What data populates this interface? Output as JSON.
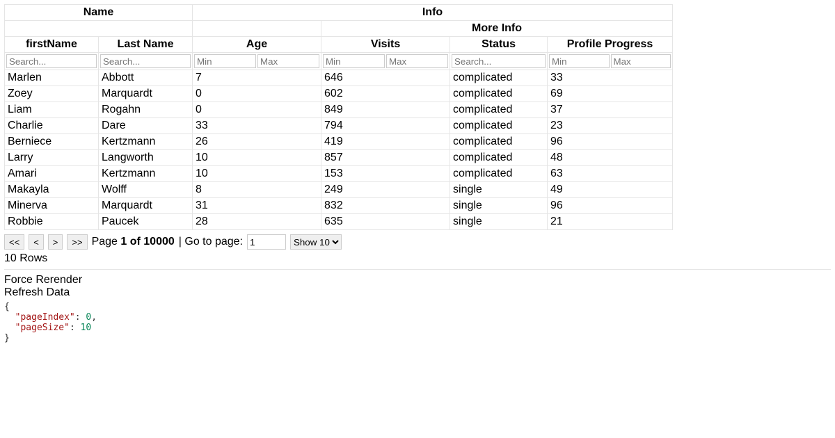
{
  "headers": {
    "group_name": "Name",
    "group_info": "Info",
    "group_more": "More Info",
    "firstName": "firstName",
    "lastName": "Last Name",
    "age": "Age",
    "visits": "Visits",
    "status": "Status",
    "progress": "Profile Progress"
  },
  "filters": {
    "search_placeholder": "Search...",
    "min_placeholder": "Min",
    "max_placeholder": "Max"
  },
  "rows": [
    {
      "firstName": "Marlen",
      "lastName": "Abbott",
      "age": 7,
      "visits": 646,
      "status": "complicated",
      "progress": 33
    },
    {
      "firstName": "Zoey",
      "lastName": "Marquardt",
      "age": 0,
      "visits": 602,
      "status": "complicated",
      "progress": 69
    },
    {
      "firstName": "Liam",
      "lastName": "Rogahn",
      "age": 0,
      "visits": 849,
      "status": "complicated",
      "progress": 37
    },
    {
      "firstName": "Charlie",
      "lastName": "Dare",
      "age": 33,
      "visits": 794,
      "status": "complicated",
      "progress": 23
    },
    {
      "firstName": "Berniece",
      "lastName": "Kertzmann",
      "age": 26,
      "visits": 419,
      "status": "complicated",
      "progress": 96
    },
    {
      "firstName": "Larry",
      "lastName": "Langworth",
      "age": 10,
      "visits": 857,
      "status": "complicated",
      "progress": 48
    },
    {
      "firstName": "Amari",
      "lastName": "Kertzmann",
      "age": 10,
      "visits": 153,
      "status": "complicated",
      "progress": 63
    },
    {
      "firstName": "Makayla",
      "lastName": "Wolff",
      "age": 8,
      "visits": 249,
      "status": "single",
      "progress": 49
    },
    {
      "firstName": "Minerva",
      "lastName": "Marquardt",
      "age": 31,
      "visits": 832,
      "status": "single",
      "progress": 96
    },
    {
      "firstName": "Robbie",
      "lastName": "Paucek",
      "age": 28,
      "visits": 635,
      "status": "single",
      "progress": 21
    }
  ],
  "pager": {
    "first": "<<",
    "prev": "<",
    "next": ">",
    "last": ">>",
    "page_label_prefix": "Page ",
    "page_current": "1",
    "page_of": " of ",
    "page_total": "10000",
    "goto_label": " | Go to page: ",
    "goto_value": "1",
    "show_prefix": "Show ",
    "show_value": "10",
    "row_count": "10 Rows"
  },
  "actions": {
    "force": "Force Rerender",
    "refresh": "Refresh Data"
  },
  "state_json": {
    "pageIndex": 0,
    "pageSize": 10
  }
}
